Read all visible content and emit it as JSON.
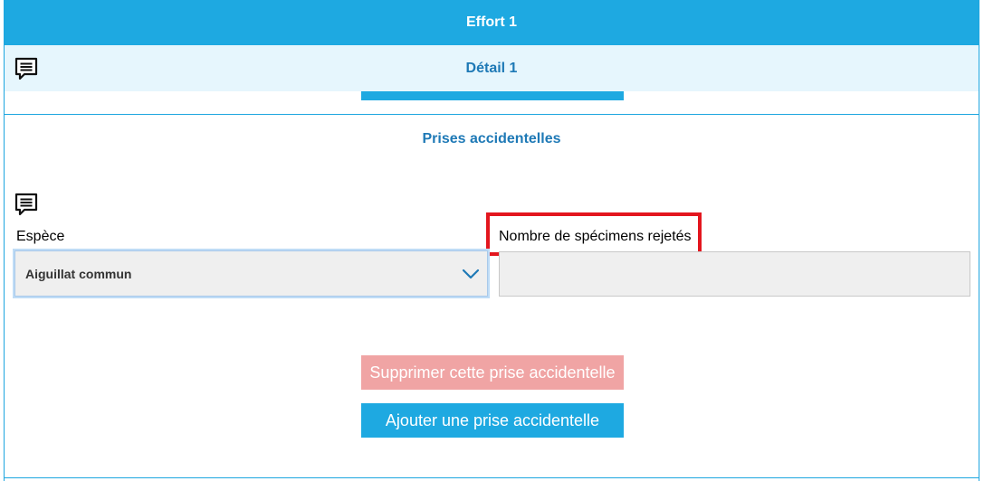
{
  "effort": {
    "title": "Effort 1"
  },
  "detail": {
    "title": "Détail 1",
    "comment_icon": "comment-icon"
  },
  "section": {
    "title": "Prises accidentelles",
    "comment_icon": "comment-icon"
  },
  "form": {
    "espece": {
      "label": "Espèce",
      "value": "Aiguillat commun"
    },
    "nombre": {
      "label": "Nombre de spécimens rejetés",
      "value": ""
    }
  },
  "buttons": {
    "delete_label": "Supprimer cette prise accidentelle",
    "add_label": "Ajouter une prise accidentelle"
  },
  "colors": {
    "accent": "#1ea9e1",
    "title_text": "#1e79b6",
    "highlight": "#e3161e",
    "delete_disabled": "#f0a4a4"
  }
}
